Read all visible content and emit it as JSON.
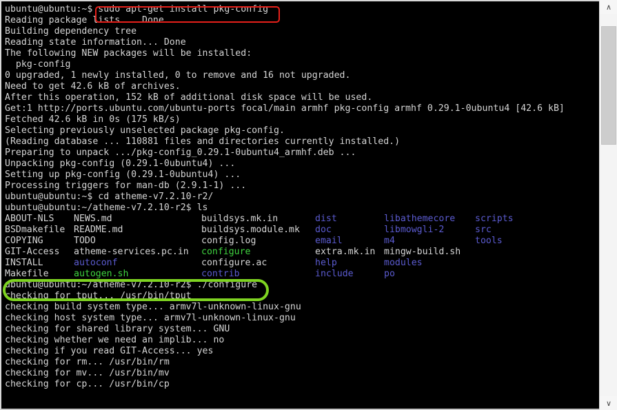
{
  "terminal": {
    "title": "ubuntu-terminal",
    "background_color": "#000000",
    "text_color": "#d6d6d6",
    "dir_color": "#5b5bd0",
    "exec_color": "#3fd33f",
    "lines": [
      "ubuntu@ubuntu:~$ sudo apt-get install pkg-config",
      "Reading package lists... Done",
      "Building dependency tree",
      "Reading state information... Done",
      "The following NEW packages will be installed:",
      "  pkg-config",
      "0 upgraded, 1 newly installed, 0 to remove and 16 not upgraded.",
      "Need to get 42.6 kB of archives.",
      "After this operation, 152 kB of additional disk space will be used.",
      "Get:1 http://ports.ubuntu.com/ubuntu-ports focal/main armhf pkg-config armhf 0.29.1-0ubuntu4 [42.6 kB]",
      "Fetched 42.6 kB in 0s (175 kB/s)",
      "Selecting previously unselected package pkg-config.",
      "(Reading database ... 110881 files and directories currently installed.)",
      "Preparing to unpack .../pkg-config_0.29.1-0ubuntu4_armhf.deb ...",
      "Unpacking pkg-config (0.29.1-0ubuntu4) ...",
      "Setting up pkg-config (0.29.1-0ubuntu4) ...",
      "Processing triggers for man-db (2.9.1-1) ...",
      "ubuntu@ubuntu:~$ cd atheme-v7.2.10-r2/",
      "ubuntu@ubuntu:~/atheme-v7.2.10-r2$ ls"
    ],
    "ls_output": {
      "rows": [
        [
          {
            "name": "ABOUT-NLS",
            "type": "file"
          },
          {
            "name": "NEWS.md",
            "type": "file"
          },
          {
            "name": "buildsys.mk.in",
            "type": "file"
          },
          {
            "name": "dist",
            "type": "dir"
          },
          {
            "name": "libathemecore",
            "type": "dir"
          },
          {
            "name": "scripts",
            "type": "dir"
          }
        ],
        [
          {
            "name": "BSDmakefile",
            "type": "file"
          },
          {
            "name": "README.md",
            "type": "file"
          },
          {
            "name": "buildsys.module.mk",
            "type": "file"
          },
          {
            "name": "doc",
            "type": "dir"
          },
          {
            "name": "libmowgli-2",
            "type": "dir"
          },
          {
            "name": "src",
            "type": "dir"
          }
        ],
        [
          {
            "name": "COPYING",
            "type": "file"
          },
          {
            "name": "TODO",
            "type": "file"
          },
          {
            "name": "config.log",
            "type": "file"
          },
          {
            "name": "email",
            "type": "dir"
          },
          {
            "name": "m4",
            "type": "dir"
          },
          {
            "name": "tools",
            "type": "dir"
          }
        ],
        [
          {
            "name": "GIT-Access",
            "type": "file"
          },
          {
            "name": "atheme-services.pc.in",
            "type": "file"
          },
          {
            "name": "configure",
            "type": "exec"
          },
          {
            "name": "extra.mk.in",
            "type": "file"
          },
          {
            "name": "mingw-build.sh",
            "type": "file"
          },
          {
            "name": "",
            "type": "file"
          }
        ],
        [
          {
            "name": "INSTALL",
            "type": "file"
          },
          {
            "name": "autoconf",
            "type": "dir"
          },
          {
            "name": "configure.ac",
            "type": "file"
          },
          {
            "name": "help",
            "type": "dir"
          },
          {
            "name": "modules",
            "type": "dir"
          },
          {
            "name": "",
            "type": "file"
          }
        ],
        [
          {
            "name": "Makefile",
            "type": "file"
          },
          {
            "name": "autogen.sh",
            "type": "exec"
          },
          {
            "name": "contrib",
            "type": "dir"
          },
          {
            "name": "include",
            "type": "dir"
          },
          {
            "name": "po",
            "type": "dir"
          },
          {
            "name": "",
            "type": "file"
          }
        ]
      ]
    },
    "lines_after": [
      "ubuntu@ubuntu:~/atheme-v7.2.10-r2$ ./configure",
      "checking for tput... /usr/bin/tput",
      "checking build system type... armv7l-unknown-linux-gnu",
      "checking host system type... armv7l-unknown-linux-gnu",
      "checking for shared library system... GNU",
      "checking whether we need an implib... no",
      "checking if you read GIT-Access... yes",
      "checking for rm... /usr/bin/rm",
      "checking for mv... /usr/bin/mv",
      "checking for cp... /usr/bin/cp"
    ]
  },
  "annotations": {
    "red_box": {
      "label": "sudo apt-get install pkg-config",
      "color": "#e8201a",
      "shape": "rectangle"
    },
    "green_box": {
      "label": "ubuntu@ubuntu:~/atheme-v7.2.10-r2$ ./configure",
      "color": "#7ed321",
      "shape": "rounded-rectangle"
    }
  },
  "scrollbar": {
    "up_arrow": "∧",
    "down_arrow": "∨",
    "thumb_position": "top"
  }
}
